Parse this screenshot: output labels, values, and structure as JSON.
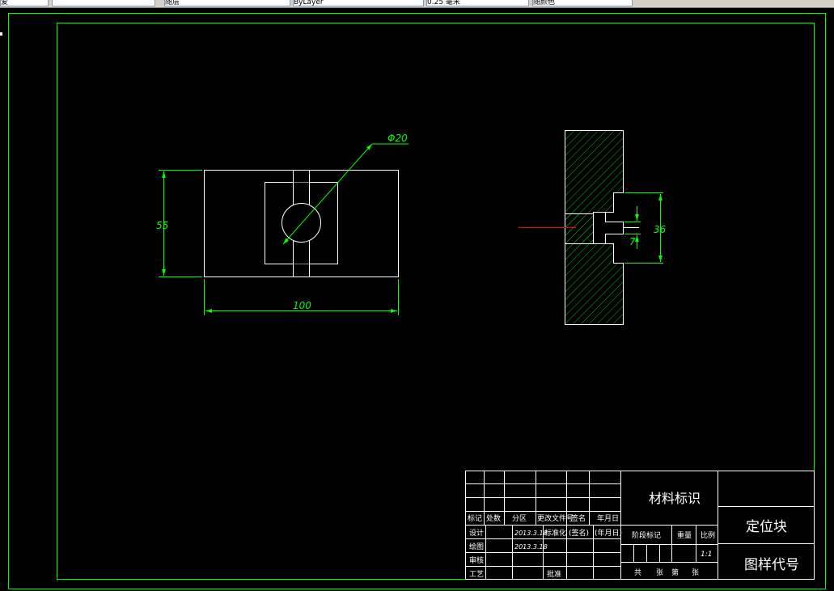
{
  "toolbar": {
    "fields": [
      {
        "name": "toolbar-field-1",
        "text": "爱"
      },
      {
        "name": "toolbar-field-2",
        "text": ""
      },
      {
        "name": "toolbar-field-3",
        "text": "随层"
      },
      {
        "name": "toolbar-field-4",
        "text": "ByLayer"
      },
      {
        "name": "toolbar-field-5",
        "text": "0.25 毫米"
      },
      {
        "name": "toolbar-field-6",
        "text": "随颜色"
      }
    ]
  },
  "colors": {
    "background": "#000000",
    "border": "#00ff00",
    "geometry": "#ffffff",
    "dimension": "#00ff00",
    "hatch": "#00c000",
    "center_line": "#ff0000"
  },
  "front_view": {
    "dim_diameter": "Φ20",
    "dim_height": "55",
    "dim_width": "100"
  },
  "section_view": {
    "dim_height": "36",
    "dim_slot": "7"
  },
  "title_block": {
    "material_label": "材料标识",
    "part_name": "定位块",
    "drawing_number_label": "图样代号",
    "header": {
      "mark": "标记",
      "count": "处数",
      "zone": "分区",
      "change_doc": "更改文件号",
      "signature": "签名",
      "date": "年月日"
    },
    "rows": {
      "design": "设计",
      "design_date": "2013.3.18",
      "standardization": "标准化",
      "sign_placeholder": "(签名)",
      "date_placeholder": "(年月日)",
      "drawing": "绘图",
      "drawing_date": "2013.3.18",
      "check": "审核",
      "process": "工艺",
      "approve": "批准"
    },
    "stage_mark": "阶段标记",
    "weight": "重量",
    "scale": "比例",
    "scale_value": "1:1",
    "total": "共",
    "sheets": "张",
    "page": "第",
    "page_sheets": "张"
  }
}
